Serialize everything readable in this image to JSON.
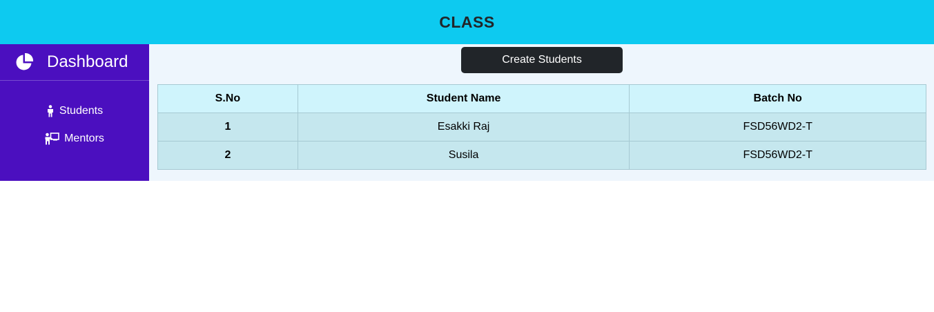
{
  "header": {
    "title": "CLASS"
  },
  "sidebar": {
    "brand_label": "Dashboard",
    "brand_icon": "pie-chart-icon",
    "items": [
      {
        "label": "Students",
        "icon": "person-icon"
      },
      {
        "label": "Mentors",
        "icon": "teacher-icon"
      }
    ]
  },
  "main": {
    "create_button_label": "Create Students",
    "table": {
      "columns": [
        "S.No",
        "Student Name",
        "Batch No"
      ],
      "rows": [
        {
          "sno": "1",
          "name": "Esakki Raj",
          "batch": "FSD56WD2-T"
        },
        {
          "sno": "2",
          "name": "Susila",
          "batch": "FSD56WD2-T"
        }
      ]
    }
  },
  "colors": {
    "header_bg": "#0dcaf0",
    "sidebar_bg": "#4b0fbf",
    "button_bg": "#212529",
    "table_header_bg": "#cff4fc",
    "table_row_bg": "#c5e7ee"
  }
}
